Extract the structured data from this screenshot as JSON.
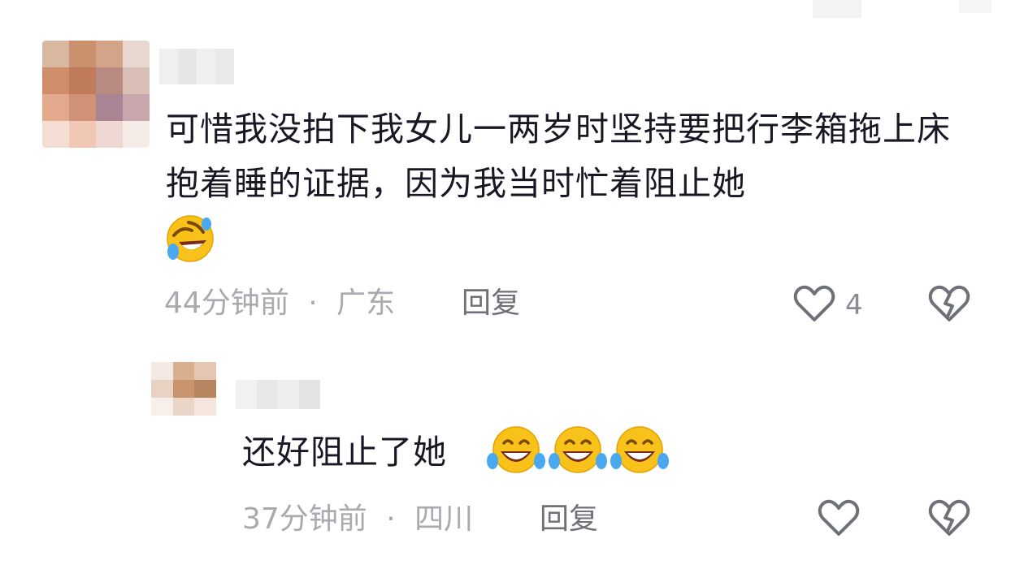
{
  "comment": {
    "text": "可惜我没拍下我女儿一两岁时坚持要把行李箱拖上床抱着睡的证据，因为我当时忙着阻止她",
    "emoji": "rolling-on-floor-laughing",
    "time": "44分钟前",
    "location": "广东",
    "reply_label": "回复",
    "like_count": "4",
    "colors": {
      "text": "#161823",
      "meta": "#a9aab0"
    }
  },
  "reply": {
    "text": "还好阻止了她",
    "emoji": [
      "tears-of-joy",
      "tears-of-joy",
      "tears-of-joy"
    ],
    "time": "37分钟前",
    "location": "四川",
    "reply_label": "回复"
  },
  "separator": "·"
}
